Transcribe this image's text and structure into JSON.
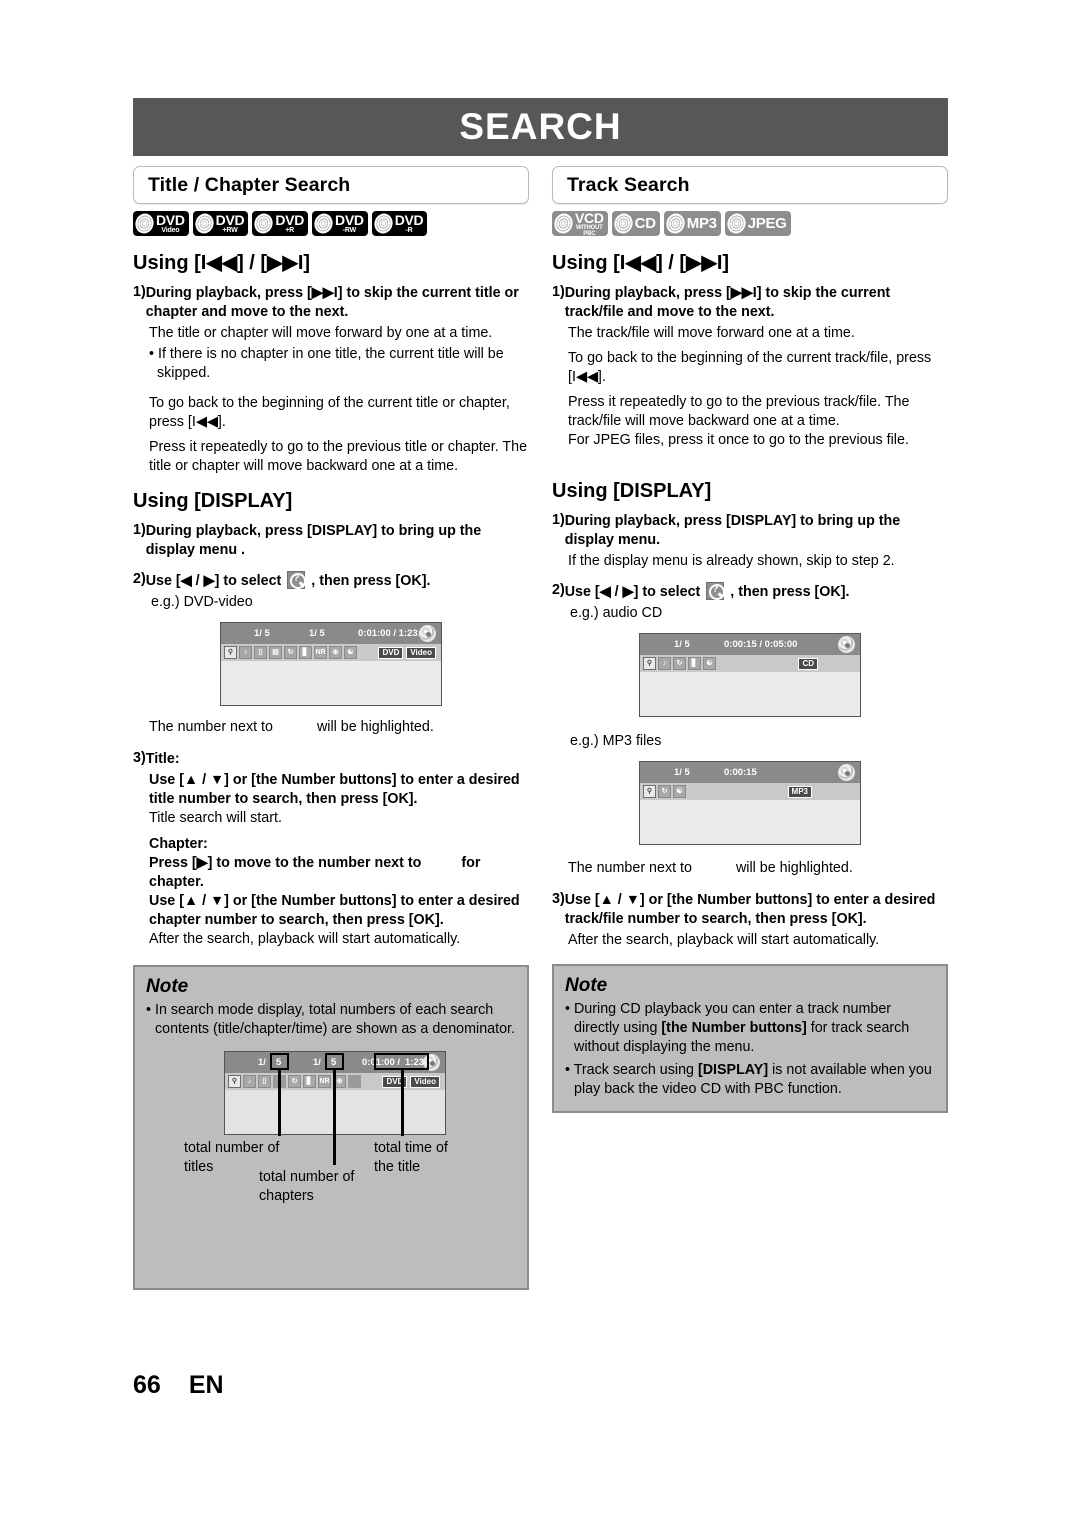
{
  "banner": {
    "title": "SEARCH"
  },
  "page_footer": {
    "number": "66",
    "lang": "EN"
  },
  "left_column": {
    "section_title": "Title / Chapter Search",
    "badges": [
      {
        "main": "DVD",
        "sub": "Video",
        "style": "black"
      },
      {
        "main": "DVD",
        "sub": "+RW",
        "style": "black"
      },
      {
        "main": "DVD",
        "sub": "+R",
        "style": "black"
      },
      {
        "main": "DVD",
        "sub": "-RW",
        "style": "black"
      },
      {
        "main": "DVD",
        "sub": "-R",
        "style": "black"
      }
    ],
    "using_skip_heading": "Using [I◀◀] / [▶▶I]",
    "step1_num": "1)",
    "step1_text": "During playback, press [▶▶I] to skip the current title or chapter and move to the next.",
    "step1_body": "The title or chapter will move forward by one at a time.",
    "step1_bullet": "• If there is no chapter in one title, the current title will be skipped.",
    "step1_body2": "To go back to the beginning of the current title or chapter, press [I◀◀].",
    "step1_body3": "Press it repeatedly to go to the previous title or chapter. The title or chapter will move backward one at a time.",
    "using_display_heading": "Using [DISPLAY]",
    "d_step1_num": "1)",
    "d_step1_text": "During playback, press [DISPLAY] to bring up the display menu .",
    "d_step2_num": "2)",
    "d_step2_pre": "Use [◀ / ▶] to select",
    "d_step2_post": ", then press [OK].",
    "d_eg": "e.g.) DVD-video",
    "osd_dvd": {
      "title_field": "1/  5",
      "chapter_field": "1/  5",
      "time_field": "0:01:00 / 1:23:45",
      "tags": [
        "DVD",
        "Video"
      ],
      "icons": [
        "search-icon",
        "audio-icon",
        "subtitle-icon",
        "angle-icon",
        "repeat-icon",
        "surround-icon",
        "noise-reduction-icon",
        "zoom-icon",
        "marker-icon"
      ]
    },
    "highlight_note_pre": "The number next to",
    "highlight_note_post": "will be highlighted.",
    "step3_num": "3)",
    "step3_title_label": "Title:",
    "step3_title_text": "Use [▲ / ▼] or [the Number buttons] to enter a desired title number to search, then press [OK].",
    "step3_title_body": "Title search will start.",
    "step3_chapter_label": "Chapter:",
    "step3_chapter_text1_pre": "Press [▶] to move to the number next to",
    "step3_chapter_text1_post": "for chapter.",
    "step3_chapter_text2": "Use [▲ / ▼] or [the Number buttons] to enter a desired chapter number to search, then press [OK].",
    "step3_body": "After the search, playback will start automatically.",
    "note": {
      "heading": "Note",
      "bullet1": "• In search mode display, total numbers of each search contents (title/chapter/time) are shown as a denominator.",
      "osd": {
        "title_num": "1/",
        "title_total": "5",
        "chapter_num": "1/",
        "chapter_total": "5",
        "time_elapsed": "0:01:00 /",
        "time_total": "1:23:45",
        "tags": [
          "DVD",
          "Video"
        ]
      },
      "caption_titles": "total number of titles",
      "caption_chapters": "total number of chapters",
      "caption_time": "total time of the title"
    }
  },
  "right_column": {
    "section_title": "Track Search",
    "badges": [
      {
        "main": "VCD",
        "sub": "WITHOUT",
        "sub2": "PBC",
        "style": "grey"
      },
      {
        "main": "CD",
        "sub": "",
        "style": "grey"
      },
      {
        "main": "MP3",
        "sub": "",
        "style": "grey"
      },
      {
        "main": "JPEG",
        "sub": "",
        "style": "grey"
      }
    ],
    "using_skip_heading": "Using [I◀◀] / [▶▶I]",
    "step1_num": "1)",
    "step1_text": "During playback, press [▶▶I] to skip the current track/file and move to the next.",
    "step1_body": "The track/file will move forward one at a time.",
    "step1_body2": "To go back to the beginning of the current track/file, press [I◀◀].",
    "step1_body3": "Press it repeatedly to go to the previous track/file. The track/file will move backward one at a time.",
    "step1_body4": "For JPEG files, press it once to go to the previous file.",
    "using_display_heading": "Using [DISPLAY]",
    "d_step1_num": "1)",
    "d_step1_text": "During playback, press [DISPLAY] to bring up the display menu.",
    "d_step1_body": "If the display menu is already shown, skip to step 2.",
    "d_step2_num": "2)",
    "d_step2_pre": "Use [◀ / ▶] to select",
    "d_step2_post": ", then press [OK].",
    "eg_cd": "e.g.) audio CD",
    "osd_cd": {
      "track_field": "1/  5",
      "time_field": "0:00:15 / 0:05:00",
      "tags": [
        "CD"
      ],
      "icons": [
        "search-icon",
        "audio-icon",
        "repeat-icon",
        "surround-icon",
        "marker-icon"
      ]
    },
    "eg_mp3": "e.g.) MP3 files",
    "osd_mp3": {
      "track_field": "1/  5",
      "time_field": "0:00:15",
      "tags": [
        "MP3"
      ],
      "icons": [
        "search-icon",
        "repeat-icon",
        "marker-icon"
      ]
    },
    "highlight_note_pre": "The number next to",
    "highlight_note_post": "will be highlighted.",
    "step3_num": "3)",
    "step3_text": "Use [▲ / ▼] or [the Number buttons] to enter a desired track/file number to search, then press [OK].",
    "step3_body": "After the search, playback will start automatically.",
    "note": {
      "heading": "Note",
      "bullet1_a": "• During CD playback you can enter a track number directly using ",
      "bullet1_b": "[the Number buttons]",
      "bullet1_c": " for track search without displaying the menu.",
      "bullet2_a": "• Track search using ",
      "bullet2_b": "[DISPLAY]",
      "bullet2_c": " is not available when you play back the video CD with PBC function."
    }
  }
}
